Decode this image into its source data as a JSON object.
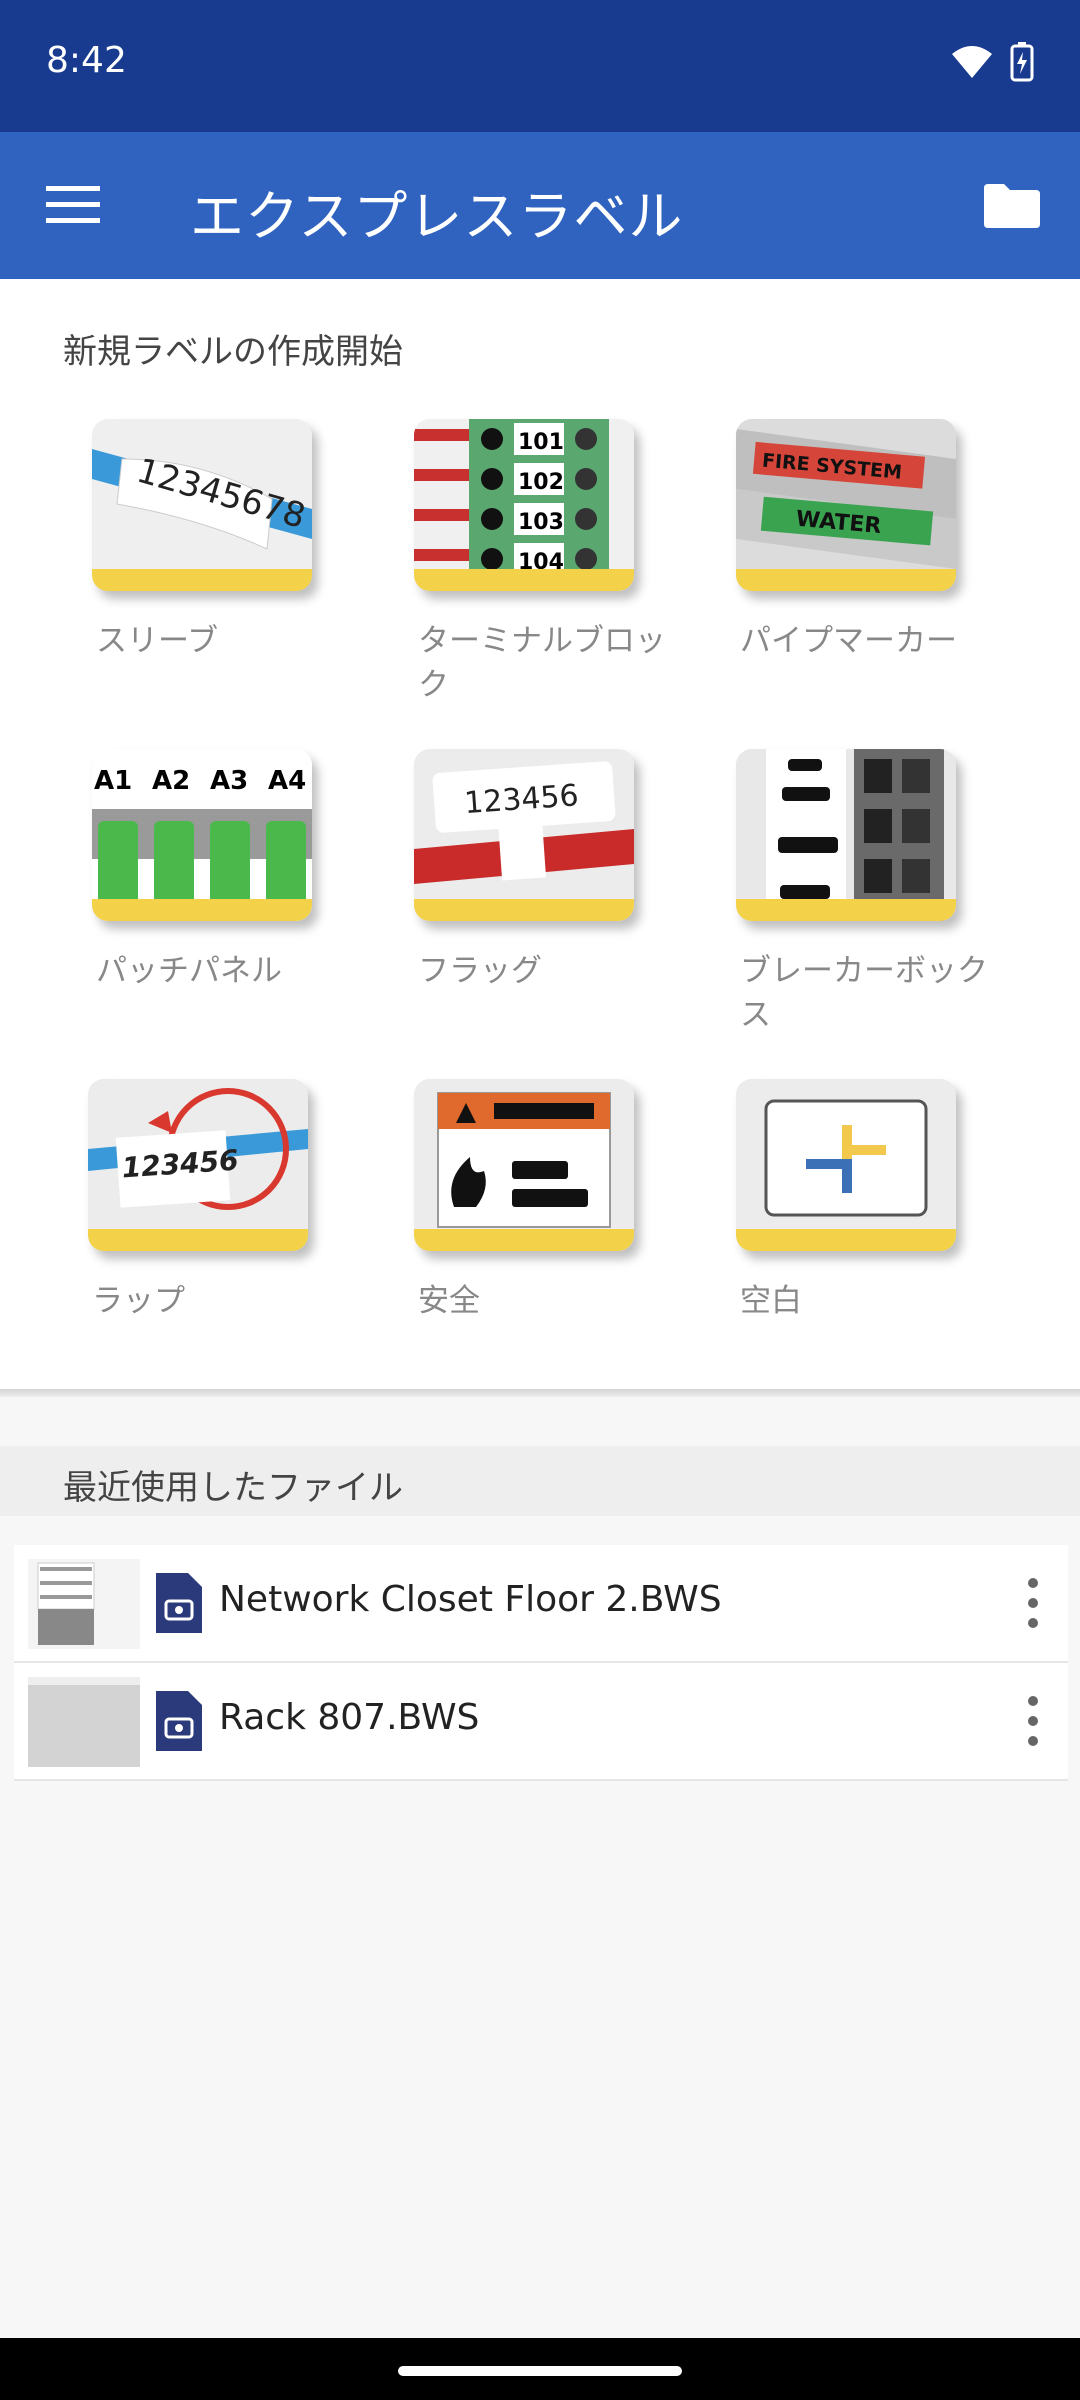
{
  "status": {
    "time": "8:42"
  },
  "appbar": {
    "title": "エクスプレスラベル"
  },
  "new_label": {
    "heading": "新規ラベルの作成開始",
    "tiles": [
      {
        "label": "スリーブ",
        "icon": "sleeve-icon"
      },
      {
        "label": "ターミナルブロック",
        "icon": "terminal-block-icon",
        "card_text": [
          "101",
          "102",
          "103",
          "104"
        ]
      },
      {
        "label": "パイプマーカー",
        "icon": "pipe-marker-icon",
        "card_text": [
          "FIRE SYSTEM",
          "WATER"
        ]
      },
      {
        "label": "パッチパネル",
        "icon": "patch-panel-icon",
        "card_text": [
          "A1",
          "A2",
          "A3",
          "A4"
        ]
      },
      {
        "label": "フラッグ",
        "icon": "flag-icon",
        "card_text": [
          "123456"
        ]
      },
      {
        "label": "ブレーカーボックス",
        "icon": "breaker-box-icon"
      },
      {
        "label": "ラップ",
        "icon": "wrap-icon",
        "card_text": [
          "123456"
        ]
      },
      {
        "label": "安全",
        "icon": "safety-icon"
      },
      {
        "label": "空白",
        "icon": "blank-icon"
      }
    ],
    "sleeve_text": "12345678"
  },
  "recent": {
    "heading": "最近使用したファイル",
    "files": [
      {
        "name": "Network Closet Floor 2.BWS"
      },
      {
        "name": "Rack 807.BWS"
      }
    ]
  },
  "colors": {
    "statusbar": "#183b8f",
    "appbar": "#2f63bf",
    "accent_yellow": "#f3d24a"
  }
}
